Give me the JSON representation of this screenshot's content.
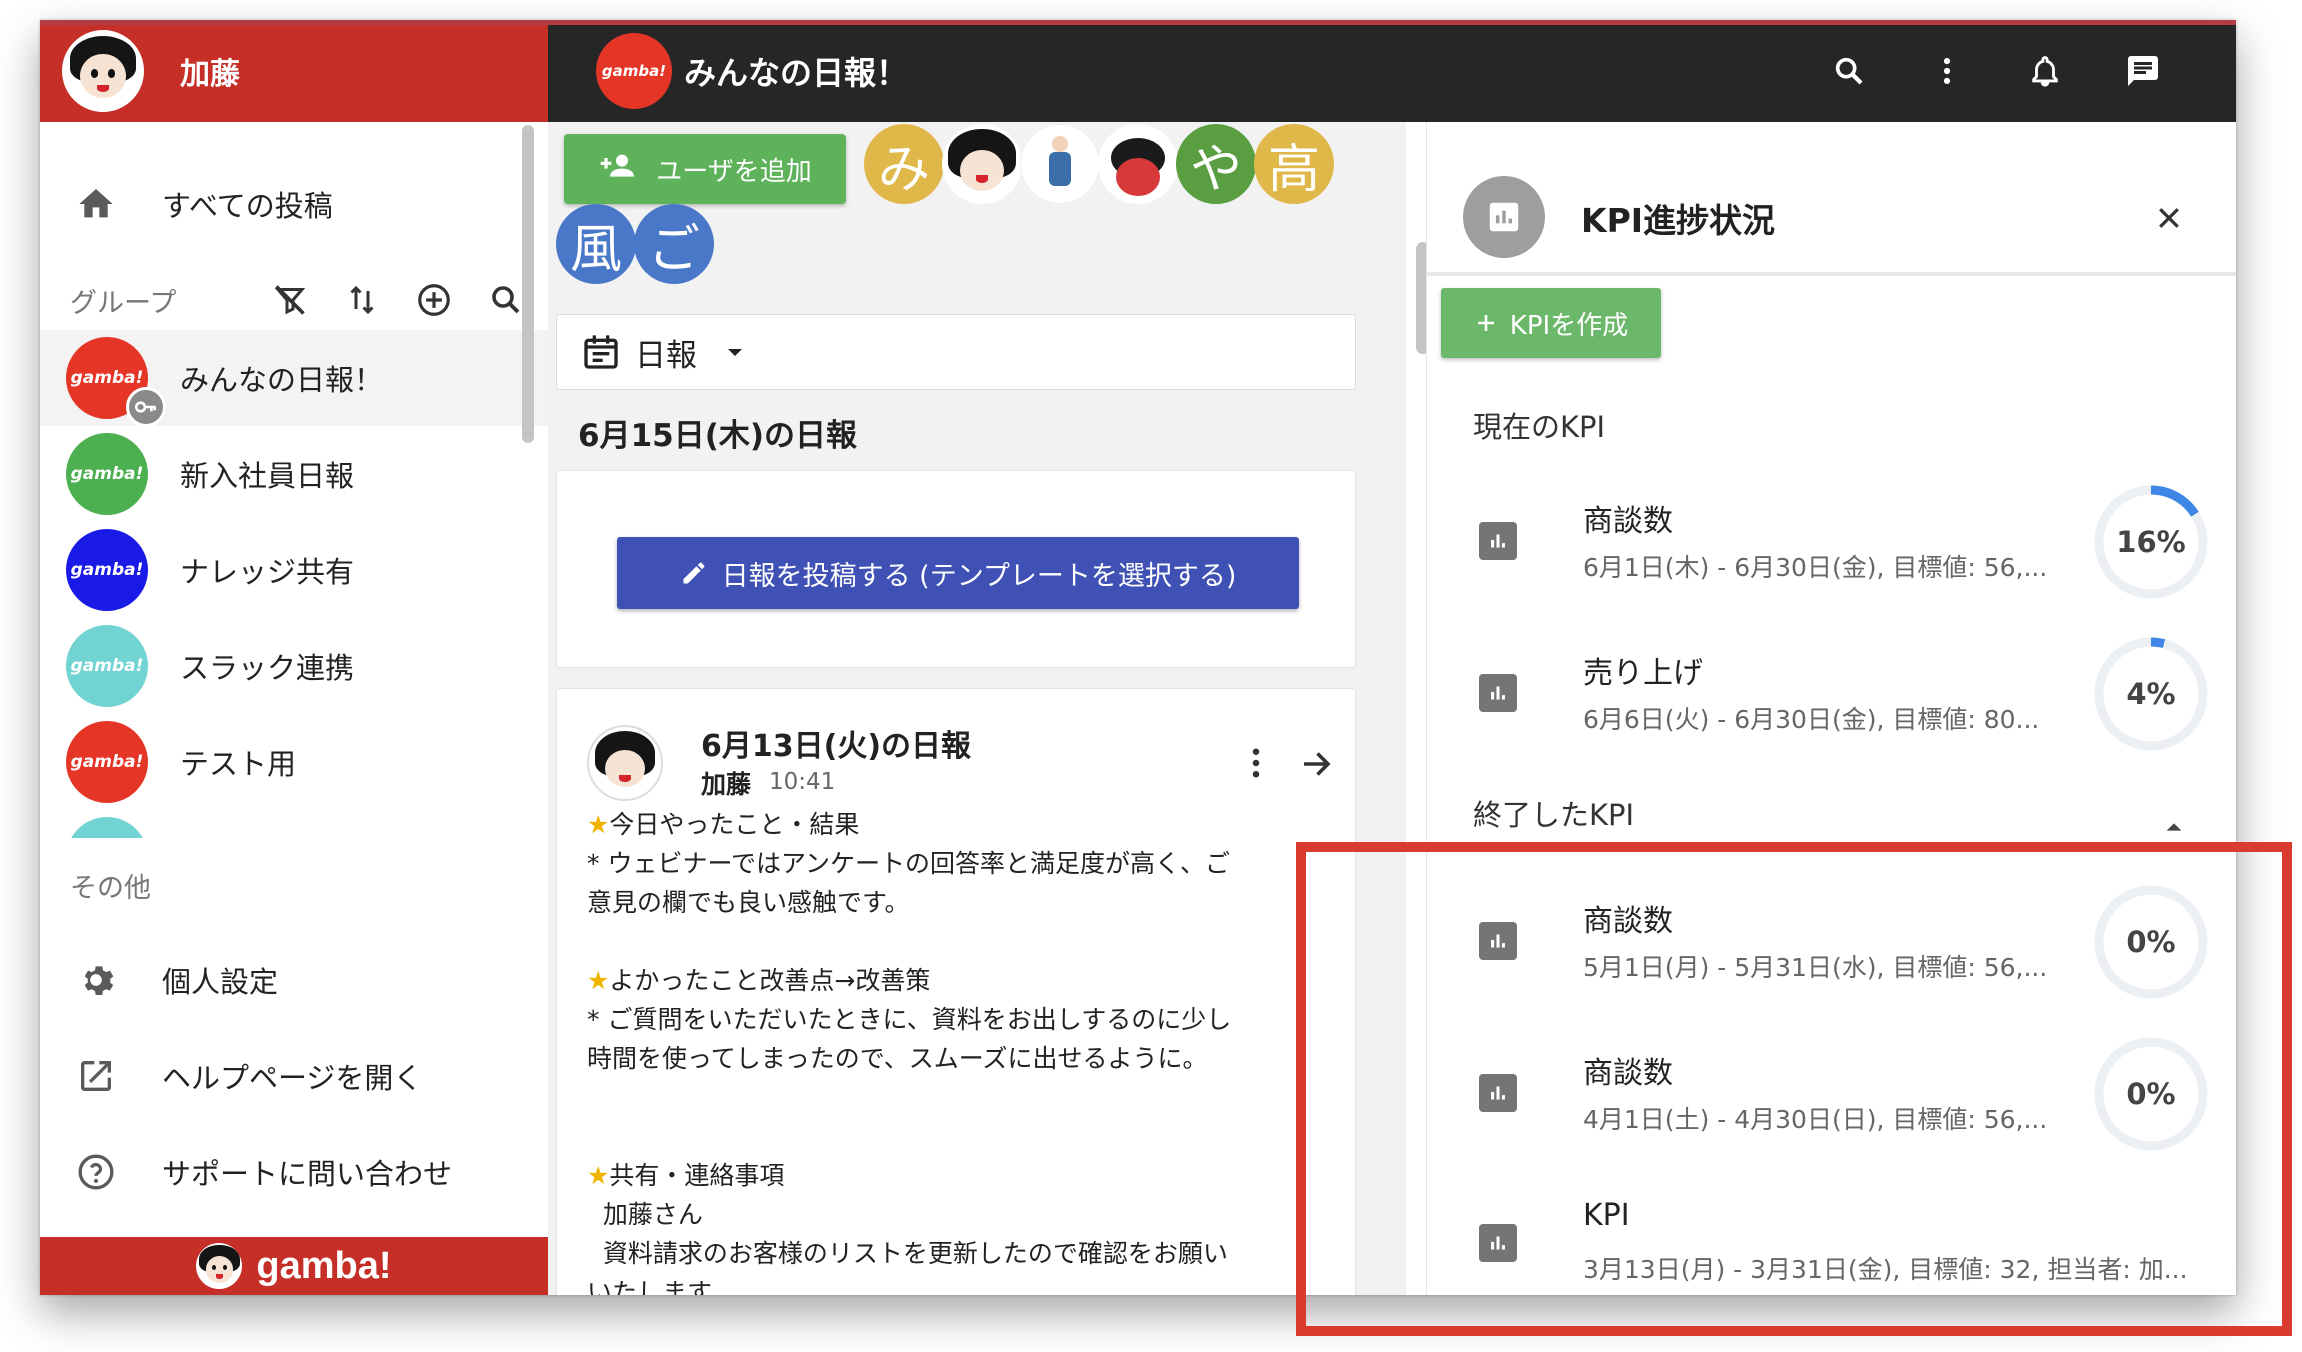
{
  "sidebar": {
    "user_name": "加藤",
    "nav": {
      "all_posts": "すべての投稿"
    },
    "groups_title": "グループ",
    "groups": [
      {
        "label": "みんなの日報！",
        "logo": "gamba!",
        "color": "#e53527",
        "active": true
      },
      {
        "label": "新入社員日報",
        "logo": "gamba!",
        "color": "#4caf50"
      },
      {
        "label": "ナレッジ共有",
        "logo": "gamba!",
        "color": "#1a1ae6"
      },
      {
        "label": "スラック連携",
        "logo": "gamba!",
        "color": "#72d4d2"
      },
      {
        "label": "テスト用",
        "logo": "gamba!",
        "color": "#e53527"
      }
    ],
    "other_title": "その他",
    "other": {
      "settings": "個人設定",
      "help": "ヘルプページを開く",
      "support": "サポートに問い合わせ"
    },
    "footer_logo": "gamba!"
  },
  "topbar": {
    "logo_text": "gamba!",
    "title": "みんなの日報！"
  },
  "center": {
    "add_user_label": "ユーザを追加",
    "members": [
      {
        "initial": "み",
        "color": "#e0b84a"
      },
      {
        "initial": "",
        "color": "#ffffff"
      },
      {
        "initial": "",
        "color": "#ffffff"
      },
      {
        "initial": "",
        "color": "#ffffff"
      },
      {
        "initial": "や",
        "color": "#5a9e42"
      },
      {
        "initial": "高",
        "color": "#e0b84a"
      },
      {
        "initial": "風",
        "color": "#4a78c8"
      },
      {
        "initial": "ご",
        "color": "#4a78c8"
      }
    ],
    "feed_type": "日報",
    "date_heading": "6月15日(木)の日報",
    "post_button_label": "日報を投稿する (テンプレートを選択する)",
    "report": {
      "title": "6月13日(火)の日報",
      "author": "加藤",
      "time": "10:41",
      "lines": [
        {
          "star": true,
          "text": "今日やったこと・結果"
        },
        {
          "star": false,
          "text": "* ウェビナーではアンケートの回答率と満足度が高く、ご"
        },
        {
          "star": false,
          "text": "意見の欄でも良い感触です。"
        },
        {
          "star": false,
          "text": ""
        },
        {
          "star": true,
          "text": "よかったこと改善点→改善策"
        },
        {
          "star": false,
          "text": "* ご質問をいただいたときに、資料をお出しするのに少し"
        },
        {
          "star": false,
          "text": "時間を使ってしまったので、スムーズに出せるように。"
        },
        {
          "star": false,
          "text": ""
        },
        {
          "star": false,
          "text": ""
        },
        {
          "star": true,
          "text": "共有・連絡事項"
        },
        {
          "star": false,
          "text": "  加藤さん"
        },
        {
          "star": false,
          "text": "  資料請求のお客様のリストを更新したので確認をお願い"
        },
        {
          "star": false,
          "text": "いたします。"
        }
      ]
    }
  },
  "kpi": {
    "title": "KPI進捗状況",
    "create_label": "KPIを作成",
    "current_title": "現在のKPI",
    "finished_title": "終了したKPI",
    "ring_color": "#3d86e6",
    "ring_track_color": "#eceff3",
    "current": [
      {
        "name": "商談数",
        "desc": "6月1日(木) - 6月30日(金), 目標値: 56,...",
        "percent_label": "16%",
        "progress": 0.16
      },
      {
        "name": "売り上げ",
        "desc": "6月6日(火) - 6月30日(金), 目標値: 80...",
        "percent_label": "4%",
        "progress": 0.04
      }
    ],
    "finished": [
      {
        "name": "商談数",
        "desc": "5月1日(月) - 5月31日(水), 目標値: 56,...",
        "percent_label": "0%",
        "progress": 0
      },
      {
        "name": "商談数",
        "desc": "4月1日(土) - 4月30日(日), 目標値: 56,...",
        "percent_label": "0%",
        "progress": 0
      },
      {
        "name": "KPI",
        "desc": "3月13日(月) - 3月31日(金), 目標値: 32, 担当者: 加...",
        "percent_label": "",
        "progress": null
      }
    ]
  },
  "annotation": {
    "highlight_color": "#db3a2e"
  }
}
